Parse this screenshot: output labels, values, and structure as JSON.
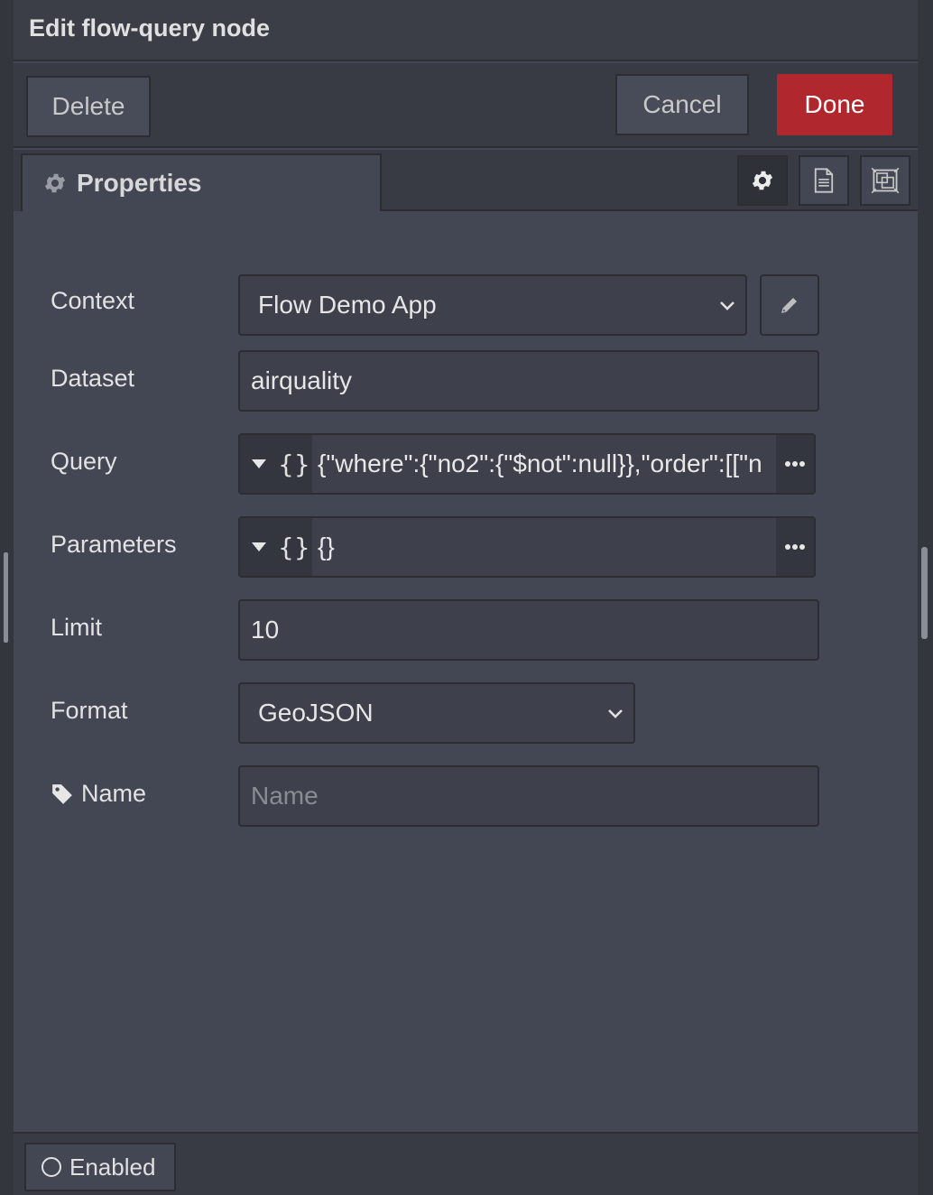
{
  "dialog": {
    "title": "Edit flow-query node"
  },
  "toolbar": {
    "delete_label": "Delete",
    "cancel_label": "Cancel",
    "done_label": "Done",
    "done_color": "#b0282e"
  },
  "tabs": {
    "active_label": "Properties",
    "active_icon": "gear-icon",
    "icon_buttons": [
      "gear-icon",
      "document-icon",
      "layout-icon"
    ]
  },
  "form": {
    "context": {
      "label": "Context",
      "value": "Flow Demo App"
    },
    "dataset": {
      "label": "Dataset",
      "value": "airquality"
    },
    "query": {
      "label": "Query",
      "type_symbol": "{}",
      "value": "{\"where\":{\"no2\":{\"$not\":null}},\"order\":[[\"n"
    },
    "parameters": {
      "label": "Parameters",
      "type_symbol": "{}",
      "value": "{}"
    },
    "limit": {
      "label": "Limit",
      "value": "10"
    },
    "format": {
      "label": "Format",
      "value": "GeoJSON"
    },
    "name": {
      "label": "Name",
      "value": "",
      "placeholder": "Name",
      "icon": "tag-icon"
    }
  },
  "footer": {
    "enabled_label": "Enabled"
  }
}
